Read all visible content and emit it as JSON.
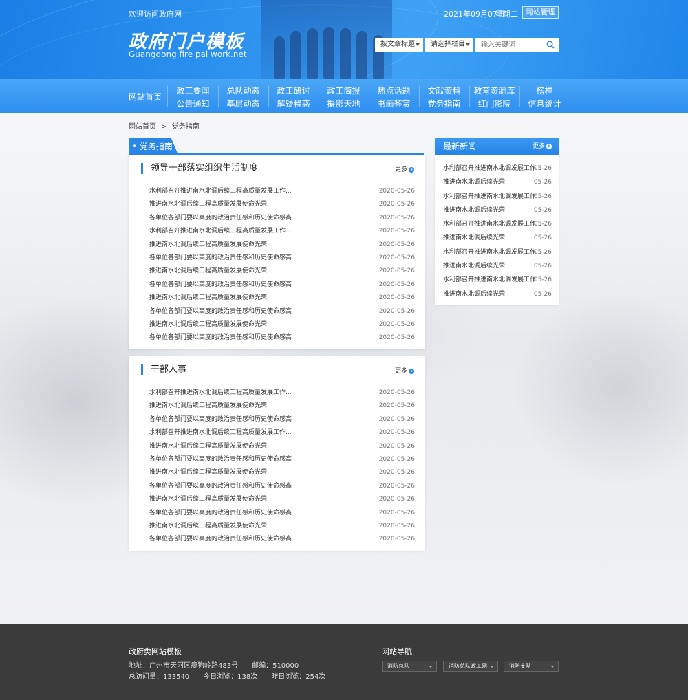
{
  "header": {
    "welcome": "欢迎访问政府网",
    "logo_title": "政府门户模板",
    "logo_subtitle": "Guangdong fire pal work.net",
    "date": "2021年09月07日",
    "weekday": "星期二",
    "admin_label": "网站管理",
    "select_title": "按文章标题",
    "select_column": "请选择栏目",
    "search_placeholder": "输入关键词"
  },
  "nav": {
    "home": "网站首页",
    "columns": [
      {
        "top": "政工要闻",
        "bottom": "公告通知"
      },
      {
        "top": "总队动态",
        "bottom": "基层动态"
      },
      {
        "top": "政工研讨",
        "bottom": "解疑释惑"
      },
      {
        "top": "政工简报",
        "bottom": "摄影天地"
      },
      {
        "top": "热点话题",
        "bottom": "书画鉴赏"
      },
      {
        "top": "文献资料",
        "bottom": "党务指南"
      },
      {
        "top": "教育资源库",
        "bottom": "红门影院"
      },
      {
        "top": "榜样",
        "bottom": "信息统计"
      }
    ]
  },
  "breadcrumb": {
    "home": "网站首页",
    "sep": ">",
    "current": "党务指南"
  },
  "section_tab": "• 党务指南",
  "more_label": "更多",
  "panel_a": {
    "title": "领导干部落实组织生活制度",
    "items": [
      {
        "text": "水利部召开推进南水北调后续工程高质量发展工作...",
        "date": "2020-05-26"
      },
      {
        "text": "推进南水北调后续工程高质量发展使命光荣",
        "date": "2020-05-26"
      },
      {
        "text": "各单位各部门要以高度的政治责任感和历史使命感高",
        "date": "2020-05-26"
      },
      {
        "text": "水利部召开推进南水北调后续工程高质量发展工作...",
        "date": "2020-05-26"
      },
      {
        "text": "推进南水北调后续工程高质量发展使命光荣",
        "date": "2020-05-26"
      },
      {
        "text": "各单位各部门要以高度的政治责任感和历史使命感高",
        "date": "2020-05-26"
      },
      {
        "text": "推进南水北调后续工程高质量发展使命光荣",
        "date": "2020-05-26"
      },
      {
        "text": "各单位各部门要以高度的政治责任感和历史使命感高",
        "date": "2020-05-26"
      },
      {
        "text": "推进南水北调后续工程高质量发展使命光荣",
        "date": "2020-05-26"
      },
      {
        "text": "各单位各部门要以高度的政治责任感和历史使命感高",
        "date": "2020-05-26"
      },
      {
        "text": "推进南水北调后续工程高质量发展使命光荣",
        "date": "2020-05-26"
      },
      {
        "text": "各单位各部门要以高度的政治责任感和历史使命感高",
        "date": "2020-05-26"
      }
    ]
  },
  "panel_b": {
    "title": "干部人事",
    "items": [
      {
        "text": "水利部召开推进南水北调后续工程高质量发展工作...",
        "date": "2020-05-26"
      },
      {
        "text": "推进南水北调后续工程高质量发展使命光荣",
        "date": "2020-05-26"
      },
      {
        "text": "各单位各部门要以高度的政治责任感和历史使命感高",
        "date": "2020-05-26"
      },
      {
        "text": "水利部召开推进南水北调后续工程高质量发展工作...",
        "date": "2020-05-26"
      },
      {
        "text": "推进南水北调后续工程高质量发展使命光荣",
        "date": "2020-05-26"
      },
      {
        "text": "各单位各部门要以高度的政治责任感和历史使命感高",
        "date": "2020-05-26"
      },
      {
        "text": "推进南水北调后续工程高质量发展使命光荣",
        "date": "2020-05-26"
      },
      {
        "text": "各单位各部门要以高度的政治责任感和历史使命感高",
        "date": "2020-05-26"
      },
      {
        "text": "推进南水北调后续工程高质量发展使命光荣",
        "date": "2020-05-26"
      },
      {
        "text": "各单位各部门要以高度的政治责任感和历史使命感高",
        "date": "2020-05-26"
      },
      {
        "text": "推进南水北调后续工程高质量发展使命光荣",
        "date": "2020-05-26"
      },
      {
        "text": "各单位各部门要以高度的政治责任感和历史使命感高",
        "date": "2020-05-26"
      }
    ]
  },
  "latest": {
    "title": "最新新闻",
    "items": [
      {
        "text": "水利部召开推进南水北调发展工作...",
        "date": "05-26"
      },
      {
        "text": "推进南水北调后续光荣",
        "date": "05-26"
      },
      {
        "text": "水利部召开推进南水北调发展工作...",
        "date": "05-26"
      },
      {
        "text": "推进南水北调后续光荣",
        "date": "05-26"
      },
      {
        "text": "水利部召开推进南水北调发展工作...",
        "date": "05-26"
      },
      {
        "text": "推进南水北调后续光荣",
        "date": "05-26"
      },
      {
        "text": "水利部召开推进南水北调发展工作...",
        "date": "05-26"
      },
      {
        "text": "推进南水北调后续光荣",
        "date": "05-26"
      },
      {
        "text": "水利部召开推进南水北调发展工作...",
        "date": "05-26"
      },
      {
        "text": "推进南水北调后续光荣",
        "date": "05-26"
      }
    ]
  },
  "footer": {
    "title": "政府类网站模板",
    "address": "地址：广州市天河区瘦狗岭路483号　　邮编：510000",
    "stats": "总访问量：133540　　今日浏览：138次　　昨日浏览：254次",
    "nav_title": "网站导航",
    "nav_selects": [
      "消防总队",
      "消防总队政工网",
      "消防支队"
    ]
  },
  "colors": {
    "primary": "#2b86ea",
    "footer_bg": "#3b3b3b"
  }
}
